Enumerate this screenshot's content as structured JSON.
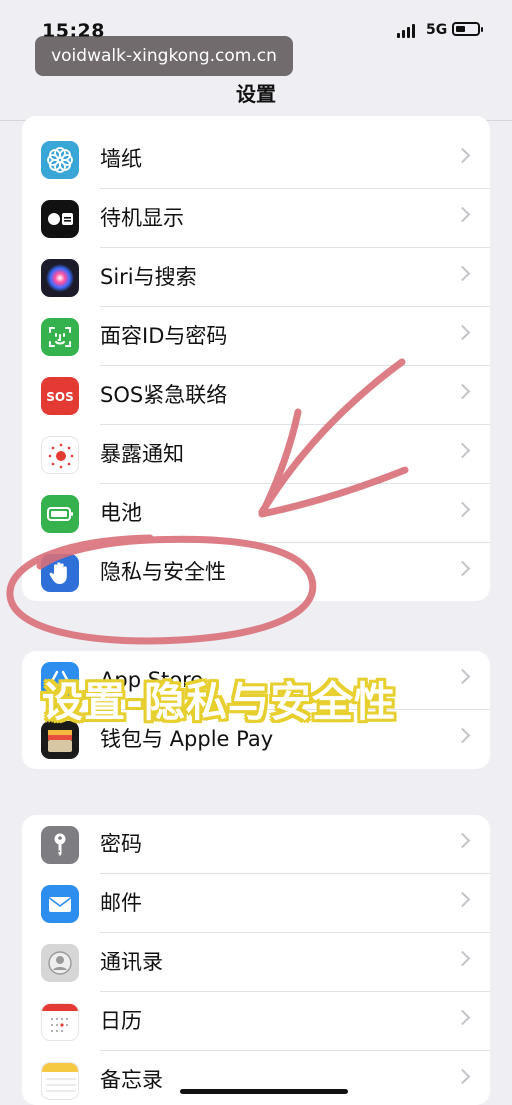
{
  "status_bar": {
    "time": "15:28",
    "network": "5G"
  },
  "watermark": "voidwalk-xingkong.com.cn",
  "header": {
    "title": "设置"
  },
  "groups": [
    {
      "items": [
        {
          "label": "墙纸",
          "icon": "wallpaper-icon"
        },
        {
          "label": "待机显示",
          "icon": "standby-icon"
        },
        {
          "label": "Siri与搜索",
          "icon": "siri-icon"
        },
        {
          "label": "面容ID与密码",
          "icon": "faceid-icon"
        },
        {
          "label": "SOS紧急联络",
          "icon": "sos-icon"
        },
        {
          "label": "暴露通知",
          "icon": "exposure-icon"
        },
        {
          "label": "电池",
          "icon": "battery-icon"
        },
        {
          "label": "隐私与安全性",
          "icon": "privacy-hand-icon"
        }
      ]
    },
    {
      "items": [
        {
          "label": "App Store",
          "icon": "app-store-icon"
        },
        {
          "label": "钱包与 Apple Pay",
          "icon": "wallet-icon"
        }
      ]
    },
    {
      "items": [
        {
          "label": "密码",
          "icon": "key-icon"
        },
        {
          "label": "邮件",
          "icon": "mail-icon"
        },
        {
          "label": "通讯录",
          "icon": "contacts-icon"
        },
        {
          "label": "日历",
          "icon": "calendar-icon"
        },
        {
          "label": "备忘录",
          "icon": "notes-icon"
        }
      ]
    }
  ],
  "overlay_caption": "设置-隐私与安全性",
  "colors": {
    "annotation": "#d9707a",
    "caption_outline": "#e6cf2e",
    "background": "#eeeef3"
  }
}
